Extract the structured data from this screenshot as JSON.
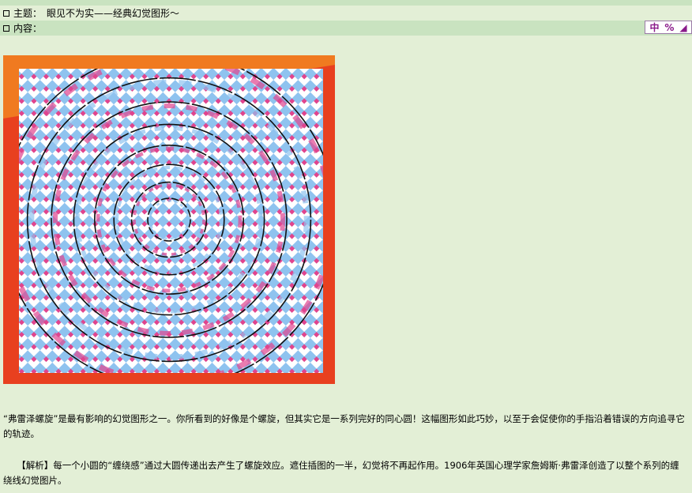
{
  "post": {
    "subject_label": "主题：",
    "subject_title": "眼见不为实——经典幻觉图形～",
    "content_label": "内容："
  },
  "badge": {
    "chars": [
      "中",
      "%",
      "◢"
    ]
  },
  "paragraphs": [
    "“弗雷泽螺旋”是最有影响的幻觉图形之一。你所看到的好像是个螺旋，但其实它是一系列完好的同心圆！这幅图形如此巧妙，以至于会促使你的手指沿着错误的方向追寻它的轨迹。",
    "　　【解析】每一个小圆的“缠绕感”通过大圆传递出去产生了螺旋效应。遮住插图的一半，幻觉将不再起作用。1906年英国心理学家詹姆斯·弗雷泽创造了以整个系列的缠绕线幻觉图片。"
  ],
  "colors": {
    "bg": "#e3efd6",
    "bar": "#c9e3c0",
    "frame_orange": "#f07a20",
    "frame_red": "#e8401f",
    "tile_blue": "#8fc3ef",
    "tile_magenta": "#e0458e"
  }
}
